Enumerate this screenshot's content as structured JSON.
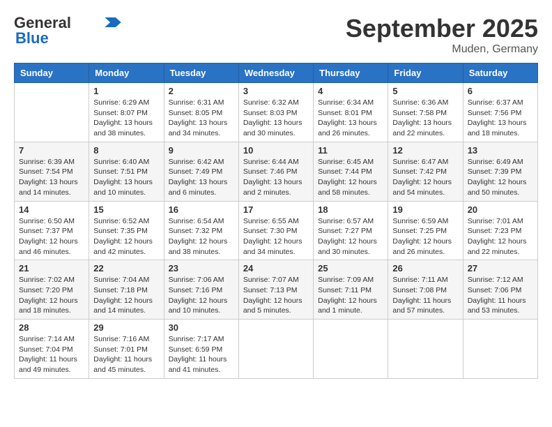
{
  "header": {
    "logo_general": "General",
    "logo_blue": "Blue",
    "month_title": "September 2025",
    "location": "Muden, Germany"
  },
  "days_of_week": [
    "Sunday",
    "Monday",
    "Tuesday",
    "Wednesday",
    "Thursday",
    "Friday",
    "Saturday"
  ],
  "weeks": [
    [
      {
        "day": "",
        "info": ""
      },
      {
        "day": "1",
        "info": "Sunrise: 6:29 AM\nSunset: 8:07 PM\nDaylight: 13 hours\nand 38 minutes."
      },
      {
        "day": "2",
        "info": "Sunrise: 6:31 AM\nSunset: 8:05 PM\nDaylight: 13 hours\nand 34 minutes."
      },
      {
        "day": "3",
        "info": "Sunrise: 6:32 AM\nSunset: 8:03 PM\nDaylight: 13 hours\nand 30 minutes."
      },
      {
        "day": "4",
        "info": "Sunrise: 6:34 AM\nSunset: 8:01 PM\nDaylight: 13 hours\nand 26 minutes."
      },
      {
        "day": "5",
        "info": "Sunrise: 6:36 AM\nSunset: 7:58 PM\nDaylight: 13 hours\nand 22 minutes."
      },
      {
        "day": "6",
        "info": "Sunrise: 6:37 AM\nSunset: 7:56 PM\nDaylight: 13 hours\nand 18 minutes."
      }
    ],
    [
      {
        "day": "7",
        "info": "Sunrise: 6:39 AM\nSunset: 7:54 PM\nDaylight: 13 hours\nand 14 minutes."
      },
      {
        "day": "8",
        "info": "Sunrise: 6:40 AM\nSunset: 7:51 PM\nDaylight: 13 hours\nand 10 minutes."
      },
      {
        "day": "9",
        "info": "Sunrise: 6:42 AM\nSunset: 7:49 PM\nDaylight: 13 hours\nand 6 minutes."
      },
      {
        "day": "10",
        "info": "Sunrise: 6:44 AM\nSunset: 7:46 PM\nDaylight: 13 hours\nand 2 minutes."
      },
      {
        "day": "11",
        "info": "Sunrise: 6:45 AM\nSunset: 7:44 PM\nDaylight: 12 hours\nand 58 minutes."
      },
      {
        "day": "12",
        "info": "Sunrise: 6:47 AM\nSunset: 7:42 PM\nDaylight: 12 hours\nand 54 minutes."
      },
      {
        "day": "13",
        "info": "Sunrise: 6:49 AM\nSunset: 7:39 PM\nDaylight: 12 hours\nand 50 minutes."
      }
    ],
    [
      {
        "day": "14",
        "info": "Sunrise: 6:50 AM\nSunset: 7:37 PM\nDaylight: 12 hours\nand 46 minutes."
      },
      {
        "day": "15",
        "info": "Sunrise: 6:52 AM\nSunset: 7:35 PM\nDaylight: 12 hours\nand 42 minutes."
      },
      {
        "day": "16",
        "info": "Sunrise: 6:54 AM\nSunset: 7:32 PM\nDaylight: 12 hours\nand 38 minutes."
      },
      {
        "day": "17",
        "info": "Sunrise: 6:55 AM\nSunset: 7:30 PM\nDaylight: 12 hours\nand 34 minutes."
      },
      {
        "day": "18",
        "info": "Sunrise: 6:57 AM\nSunset: 7:27 PM\nDaylight: 12 hours\nand 30 minutes."
      },
      {
        "day": "19",
        "info": "Sunrise: 6:59 AM\nSunset: 7:25 PM\nDaylight: 12 hours\nand 26 minutes."
      },
      {
        "day": "20",
        "info": "Sunrise: 7:01 AM\nSunset: 7:23 PM\nDaylight: 12 hours\nand 22 minutes."
      }
    ],
    [
      {
        "day": "21",
        "info": "Sunrise: 7:02 AM\nSunset: 7:20 PM\nDaylight: 12 hours\nand 18 minutes."
      },
      {
        "day": "22",
        "info": "Sunrise: 7:04 AM\nSunset: 7:18 PM\nDaylight: 12 hours\nand 14 minutes."
      },
      {
        "day": "23",
        "info": "Sunrise: 7:06 AM\nSunset: 7:16 PM\nDaylight: 12 hours\nand 10 minutes."
      },
      {
        "day": "24",
        "info": "Sunrise: 7:07 AM\nSunset: 7:13 PM\nDaylight: 12 hours\nand 5 minutes."
      },
      {
        "day": "25",
        "info": "Sunrise: 7:09 AM\nSunset: 7:11 PM\nDaylight: 12 hours\nand 1 minute."
      },
      {
        "day": "26",
        "info": "Sunrise: 7:11 AM\nSunset: 7:08 PM\nDaylight: 11 hours\nand 57 minutes."
      },
      {
        "day": "27",
        "info": "Sunrise: 7:12 AM\nSunset: 7:06 PM\nDaylight: 11 hours\nand 53 minutes."
      }
    ],
    [
      {
        "day": "28",
        "info": "Sunrise: 7:14 AM\nSunset: 7:04 PM\nDaylight: 11 hours\nand 49 minutes."
      },
      {
        "day": "29",
        "info": "Sunrise: 7:16 AM\nSunset: 7:01 PM\nDaylight: 11 hours\nand 45 minutes."
      },
      {
        "day": "30",
        "info": "Sunrise: 7:17 AM\nSunset: 6:59 PM\nDaylight: 11 hours\nand 41 minutes."
      },
      {
        "day": "",
        "info": ""
      },
      {
        "day": "",
        "info": ""
      },
      {
        "day": "",
        "info": ""
      },
      {
        "day": "",
        "info": ""
      }
    ]
  ]
}
